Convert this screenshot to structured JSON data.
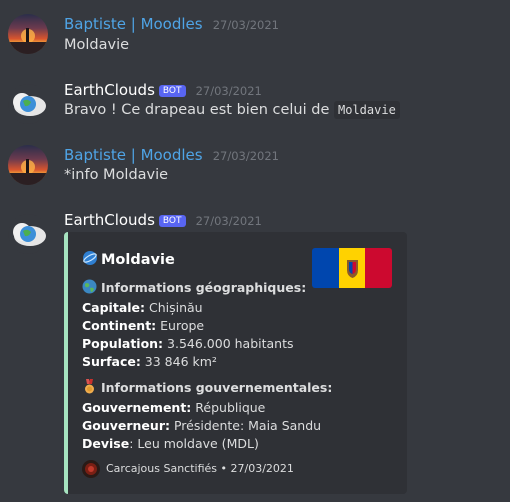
{
  "colors": {
    "username": "#4fa4e6",
    "bot_tag": "#5865f2",
    "embed_border": "#a6e3c0",
    "background": "#36393f"
  },
  "messages": [
    {
      "author": "Baptiste | Moodles",
      "time": "27/03/2021",
      "text": "Moldavie"
    },
    {
      "author": "EarthClouds",
      "bot_tag": "BOT",
      "time": "27/03/2021",
      "text": "Bravo ! Ce drapeau est bien celui de ",
      "code": "Moldavie"
    },
    {
      "author": "Baptiste | Moodles",
      "time": "27/03/2021",
      "text": "*info Moldavie"
    },
    {
      "author": "EarthClouds",
      "bot_tag": "BOT",
      "time": "27/03/2021"
    }
  ],
  "embed": {
    "title": "Moldavie",
    "title_icon": "blue-planet-icon",
    "geo": {
      "header": "Informations géographiques:",
      "icon": "globe-icon",
      "capital_label": "Capitale:",
      "capital": " Chișinău",
      "continent_label": "Continent:",
      "continent": " Europe",
      "population_label": "Population:",
      "population": " 3.546.000 habitants",
      "surface_label": "Surface:",
      "surface": " 33 846 km²"
    },
    "gov": {
      "header": "Informations gouvernementales:",
      "icon": "medal-icon",
      "government_label": "Gouvernement:",
      "government": " République",
      "governor_label": "Gouverneur:",
      "governor": " Présidente: Maia Sandu",
      "currency_label": "Devise",
      "currency": ": Leu moldave (MDL)"
    },
    "footer": {
      "text": "Carcajous Sanctifiés • 27/03/2021",
      "icon": "server-avatar-icon"
    },
    "flag_colors": [
      "#0046ae",
      "#ffd200",
      "#cc092f"
    ]
  }
}
